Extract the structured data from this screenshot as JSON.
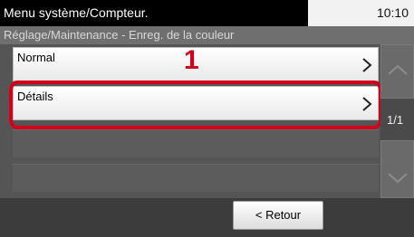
{
  "header": {
    "title": "Menu système/Compteur.",
    "time": "10:10",
    "breadcrumb": "Réglage/Maintenance - Enreg. de la couleur"
  },
  "list": {
    "items": [
      {
        "label": "Normal"
      },
      {
        "label": "Détails"
      }
    ]
  },
  "annotation": {
    "step_number": "1",
    "highlight_color": "#d4001a"
  },
  "pager": {
    "indicator": "1/1"
  },
  "footer": {
    "back_label": "< Retour"
  }
}
